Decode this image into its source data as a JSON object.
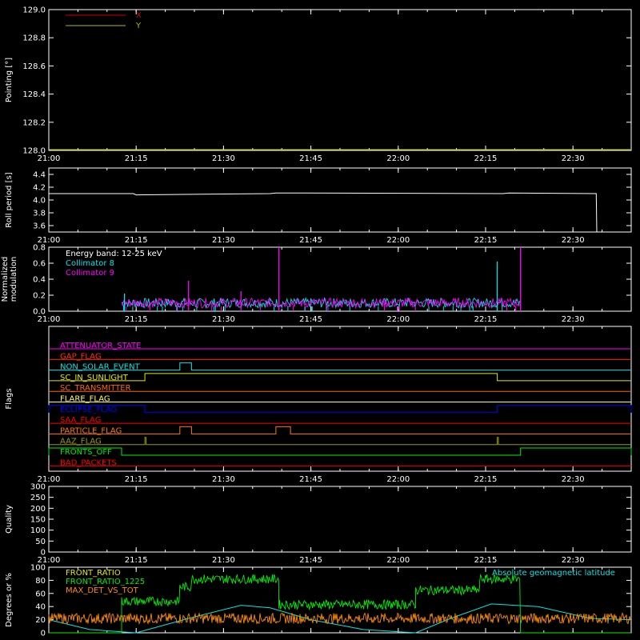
{
  "colors": {
    "background": "#000000",
    "axes": "#ffffff",
    "x_series": "#cc0000",
    "y_series": "#b8b800",
    "roll": "#ffffff",
    "collimator8": "#00e6e6",
    "collimator9": "#ff00ff",
    "front_ratio": "#e6e600",
    "front_ratio_1225": "#00ee00",
    "max_det": "#ff8c00",
    "geo_lat": "#00e6e6"
  },
  "time_axis": {
    "start": "21:00",
    "end": "22:40",
    "tick_labels": [
      "21:00",
      "21:15",
      "21:30",
      "21:45",
      "22:00",
      "22:15",
      "22:30"
    ]
  },
  "chart_data": [
    {
      "type": "line",
      "id": "pointing",
      "ylabel": "Pointing [°]",
      "ylim": [
        128.0,
        129.0
      ],
      "ytick_labels": [
        "128.0",
        "128.2",
        "128.4",
        "128.6",
        "128.8",
        "129.0"
      ],
      "legend": [
        {
          "name": "X",
          "color": "#cc0000"
        },
        {
          "name": "Y",
          "color": "#b8b800"
        }
      ],
      "series": [
        {
          "name": "Y",
          "x": [
            "21:00",
            "22:40"
          ],
          "values": [
            128.0,
            128.0
          ]
        }
      ]
    },
    {
      "type": "line",
      "id": "roll",
      "ylabel": "Roll period [s]",
      "ylim": [
        3.5,
        4.5
      ],
      "ytick_labels": [
        "3.6",
        "3.8",
        "4.0",
        "4.2",
        "4.4"
      ],
      "series": [
        {
          "name": "",
          "x": [
            "21:00",
            "21:14.5",
            "21:15",
            "21:38",
            "21:39",
            "22:18",
            "22:19",
            "22:34",
            "22:34.1"
          ],
          "values": [
            4.1,
            4.1,
            4.08,
            4.1,
            4.11,
            4.1,
            4.11,
            4.1,
            3.5
          ]
        }
      ]
    },
    {
      "type": "line",
      "id": "modulation",
      "ylabel": "Normalized modulation",
      "ylim": [
        0.0,
        0.8
      ],
      "ytick_labels": [
        "0.0",
        "0.2",
        "0.4",
        "0.6",
        "0.8"
      ],
      "annotation": "Energy band: 12-25 keV",
      "legend": [
        {
          "name": "Collimator 8",
          "color": "#00e6e6"
        },
        {
          "name": "Collimator 9",
          "color": "#ff00ff"
        }
      ],
      "x_range": [
        "21:12.5",
        "22:21"
      ],
      "baseline": 0.08,
      "spikes": [
        {
          "series": "Collimator 9",
          "x": "21:39.5",
          "value": 0.8
        },
        {
          "series": "Collimator 9",
          "x": "22:21",
          "value": 0.8
        },
        {
          "series": "Collimator 8",
          "x": "22:17",
          "value": 0.62
        },
        {
          "series": "Collimator 9",
          "x": "21:24",
          "value": 0.38
        },
        {
          "series": "Collimator 8",
          "x": "21:13",
          "value": 0.22
        },
        {
          "series": "Collimator 9",
          "x": "21:33",
          "value": 0.25
        }
      ]
    },
    {
      "type": "line",
      "id": "flags",
      "ylabel": "Flags",
      "flags": [
        {
          "label": "ATTENUATOR_STATE",
          "color": "#ff00ff",
          "high": []
        },
        {
          "label": "GAP_FLAG",
          "color": "#ff3300",
          "high": []
        },
        {
          "label": "NON_SOLAR_EVENT",
          "color": "#00e6e6",
          "high": [
            [
              "21:22.5",
              "21:24.5"
            ]
          ]
        },
        {
          "label": "SC_IN_SUNLIGHT",
          "color": "#e6e600",
          "high": [
            [
              "21:16.5",
              "22:17"
            ]
          ]
        },
        {
          "label": "SC_TRANSMITTER",
          "color": "#ff6600",
          "high": []
        },
        {
          "label": "FLARE_FLAG",
          "color": "#ffff66",
          "high": []
        },
        {
          "label": "ECLIPSE_FLAG",
          "color": "#0000ff",
          "high": [
            [
              "21:00",
              "21:16.5"
            ],
            [
              "22:17",
              "22:40"
            ]
          ]
        },
        {
          "label": "SAA_FLAG",
          "color": "#ff0000",
          "high": []
        },
        {
          "label": "PARTICLE_FLAG",
          "color": "#ff7700",
          "high": [
            [
              "21:22.5",
              "21:24.5"
            ],
            [
              "21:39",
              "21:41.5"
            ]
          ]
        },
        {
          "label": "AAZ_FLAG",
          "color": "#999900",
          "high": [
            [
              "21:16.5",
              "21:16.7"
            ],
            [
              "22:17",
              "22:17.2"
            ]
          ]
        },
        {
          "label": "FRONTS_OFF",
          "color": "#00ee00",
          "high": [
            [
              "21:00",
              "21:12.5"
            ],
            [
              "22:21",
              "22:40"
            ]
          ]
        },
        {
          "label": "BAD_PACKETS",
          "color": "#ff0000",
          "high": []
        }
      ]
    },
    {
      "type": "line",
      "id": "quality",
      "ylabel": "Quality",
      "ylim": [
        0,
        300
      ],
      "ytick_labels": [
        "0",
        "50",
        "100",
        "150",
        "200",
        "250",
        "300"
      ]
    },
    {
      "type": "line",
      "id": "ratios",
      "ylabel": "Degrees or %",
      "ylim": [
        0,
        100
      ],
      "ytick_labels": [
        "0",
        "20",
        "40",
        "60",
        "80",
        "100"
      ],
      "legend": [
        {
          "name": "FRONT_RATIO",
          "color": "#e6e600"
        },
        {
          "name": "FRONT_RATIO_1225",
          "color": "#00ee00"
        },
        {
          "name": "MAX_DET_VS_TOT",
          "color": "#ff8c00"
        }
      ],
      "right_legend": {
        "name": "Absolute geomagnetic latitude",
        "color": "#00e6e6"
      },
      "front_ratio_1225_levels": [
        {
          "from": "21:00",
          "to": "21:12.5",
          "value": 0
        },
        {
          "from": "21:12.5",
          "to": "21:22.5",
          "value": 48
        },
        {
          "from": "21:22.5",
          "to": "21:24.5",
          "value": 70
        },
        {
          "from": "21:24.5",
          "to": "21:39.5",
          "value": 82
        },
        {
          "from": "21:39.5",
          "to": "22:03",
          "value": 43
        },
        {
          "from": "22:03",
          "to": "22:14",
          "value": 65
        },
        {
          "from": "22:14",
          "to": "22:21",
          "value": 82
        },
        {
          "from": "22:21",
          "to": "22:40",
          "value": 0
        }
      ],
      "max_det_level": 22,
      "geo_lat": {
        "x": [
          "21:00",
          "21:07",
          "21:15",
          "21:24",
          "21:33",
          "21:38",
          "21:45",
          "21:54",
          "22:03",
          "22:09",
          "22:16",
          "22:24",
          "22:33",
          "22:40"
        ],
        "values": [
          20,
          5,
          0,
          22,
          42,
          38,
          20,
          5,
          0,
          22,
          44,
          40,
          22,
          20
        ]
      }
    }
  ]
}
